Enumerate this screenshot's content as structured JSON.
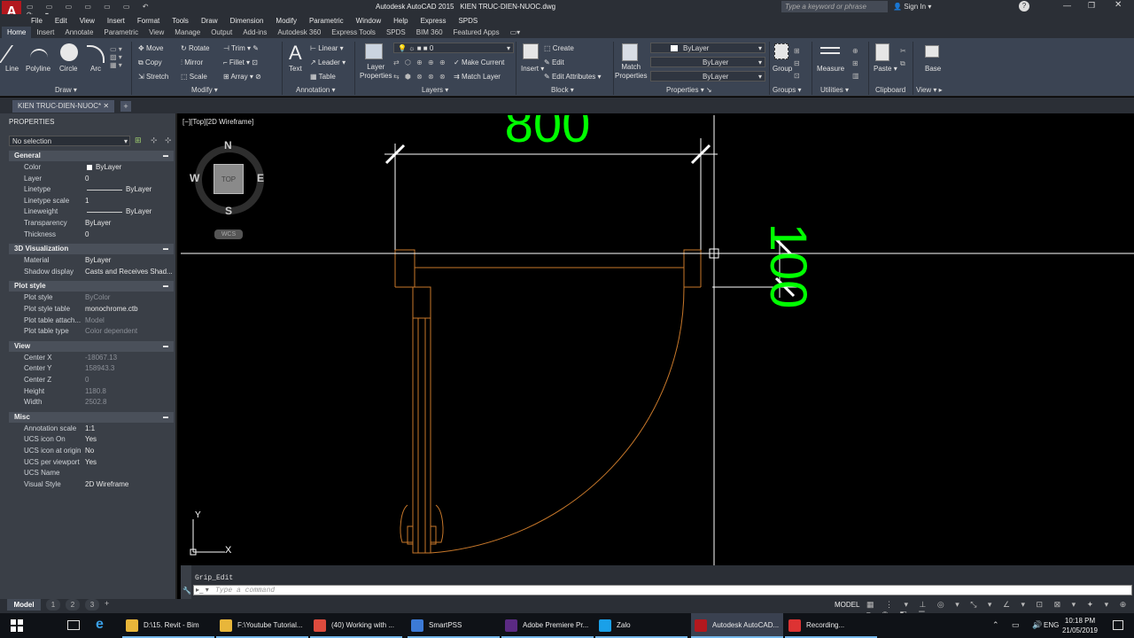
{
  "titlebar": {
    "app_title": "Autodesk AutoCAD 2015",
    "file_name": "KIEN TRUC-DIEN-NUOC.dwg",
    "search_placeholder": "Type a keyword or phrase",
    "sign_in": "Sign In"
  },
  "menu": [
    "File",
    "Edit",
    "View",
    "Insert",
    "Format",
    "Tools",
    "Draw",
    "Dimension",
    "Modify",
    "Parametric",
    "Window",
    "Help",
    "Express",
    "SPDS"
  ],
  "ribbon_tabs": [
    "Home",
    "Insert",
    "Annotate",
    "Parametric",
    "View",
    "Manage",
    "Output",
    "Add-ins",
    "Autodesk 360",
    "Express Tools",
    "SPDS",
    "BIM 360",
    "Featured Apps"
  ],
  "ribbon": {
    "draw": {
      "line": "Line",
      "polyline": "Polyline",
      "circle": "Circle",
      "arc": "Arc",
      "panel": "Draw"
    },
    "modify": {
      "move": "Move",
      "rotate": "Rotate",
      "trim": "Trim",
      "copy": "Copy",
      "mirror": "Mirror",
      "fillet": "Fillet",
      "stretch": "Stretch",
      "scale": "Scale",
      "array": "Array",
      "panel": "Modify"
    },
    "annotation": {
      "text": "Text",
      "linear": "Linear",
      "leader": "Leader",
      "table": "Table",
      "panel": "Annotation"
    },
    "layers": {
      "layer_properties_1": "Layer",
      "layer_properties_2": "Properties",
      "current_layer": "0",
      "make_current": "Make Current",
      "match_layer": "Match Layer",
      "panel": "Layers"
    },
    "block": {
      "insert": "Insert",
      "create": "Create",
      "edit": "Edit",
      "edit_attributes": "Edit Attributes",
      "panel": "Block"
    },
    "properties": {
      "match_1": "Match",
      "match_2": "Properties",
      "color": "ByLayer",
      "linetype": "ByLayer",
      "lineweight": "ByLayer",
      "panel": "Properties"
    },
    "groups": {
      "group": "Group",
      "panel": "Groups"
    },
    "utilities": {
      "measure": "Measure",
      "panel": "Utilities"
    },
    "clipboard": {
      "paste": "Paste",
      "panel": "Clipboard"
    },
    "view": {
      "base": "Base",
      "panel": "View"
    }
  },
  "file_tab": "KIEN TRUC-DIEN-NUOC*",
  "properties_palette": {
    "title": "PROPERTIES",
    "selection": "No selection",
    "sections": [
      {
        "name": "General",
        "rows": [
          [
            "Color",
            "ByLayer"
          ],
          [
            "Layer",
            "0"
          ],
          [
            "Linetype",
            "ByLayer"
          ],
          [
            "Linetype scale",
            "1"
          ],
          [
            "Lineweight",
            "ByLayer"
          ],
          [
            "Transparency",
            "ByLayer"
          ],
          [
            "Thickness",
            "0"
          ]
        ]
      },
      {
        "name": "3D Visualization",
        "rows": [
          [
            "Material",
            "ByLayer"
          ],
          [
            "Shadow display",
            "Casts and Receives Shad..."
          ]
        ]
      },
      {
        "name": "Plot style",
        "rows": [
          [
            "Plot style",
            "ByColor"
          ],
          [
            "Plot style table",
            "monochrome.ctb"
          ],
          [
            "Plot table attach...",
            "Model"
          ],
          [
            "Plot table type",
            "Color dependent"
          ]
        ]
      },
      {
        "name": "View",
        "rows": [
          [
            "Center X",
            "-18067.13"
          ],
          [
            "Center Y",
            "158943.3"
          ],
          [
            "Center Z",
            "0"
          ],
          [
            "Height",
            "1180.8"
          ],
          [
            "Width",
            "2502.8"
          ]
        ]
      },
      {
        "name": "Misc",
        "rows": [
          [
            "Annotation scale",
            "1:1"
          ],
          [
            "UCS icon On",
            "Yes"
          ],
          [
            "UCS icon at origin",
            "No"
          ],
          [
            "UCS per viewport",
            "Yes"
          ],
          [
            "UCS Name",
            ""
          ],
          [
            "Visual Style",
            "2D Wireframe"
          ]
        ]
      }
    ]
  },
  "viewport": {
    "label": "[−][Top][2D Wireframe]",
    "compass": {
      "n": "N",
      "s": "S",
      "e": "E",
      "w": "W",
      "top": "TOP",
      "wcs": "WCS"
    },
    "dim_top": "800",
    "dim_right": "100",
    "ucs_y": "Y",
    "ucs_x": "X"
  },
  "command": {
    "history": "Grip_Edit",
    "placeholder": "Type a command"
  },
  "layout_tabs": [
    "Model",
    "1",
    "2",
    "3"
  ],
  "status": {
    "model": "MODEL"
  },
  "taskbar": {
    "items": [
      "D:\\15. Revit - Bim",
      "F:\\Youtube Tutorial...",
      "(40) Working with ...",
      "SmartPSS",
      "Adobe Premiere Pr...",
      "Zalo",
      "Autodesk AutoCAD...",
      "Recording..."
    ],
    "lang": "ENG",
    "time": "10:18 PM",
    "date": "21/05/2019"
  },
  "colors": {
    "dim_green": "#00ff00",
    "door_orange": "#c8782a",
    "crosshair": "#ffffff"
  }
}
